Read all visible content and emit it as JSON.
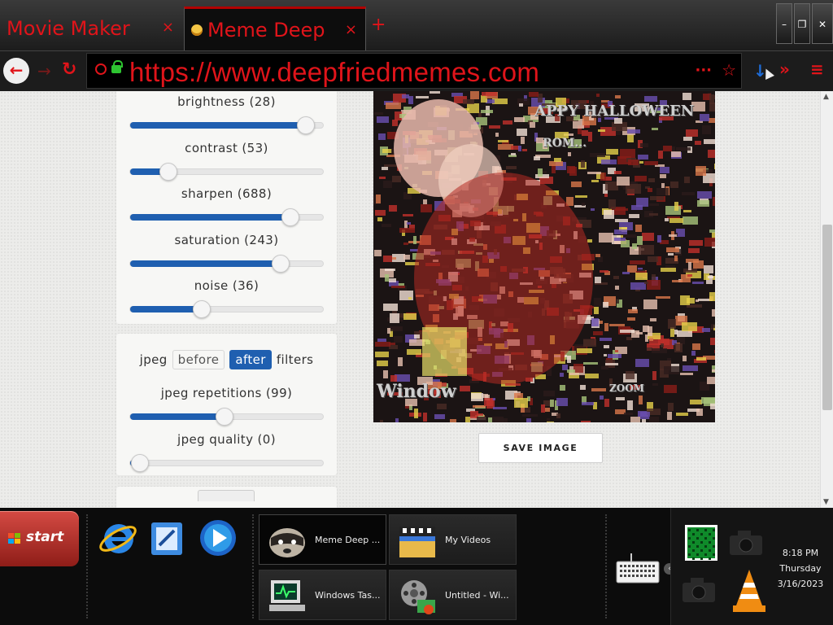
{
  "browser": {
    "tabs": [
      {
        "label": "Movie Maker",
        "active": false
      },
      {
        "label": "Meme Deep",
        "active": true
      }
    ],
    "tab_close": "×",
    "new_tab": "+",
    "window_buttons": {
      "minimize": "–",
      "restore": "❐",
      "close": "✕"
    },
    "url": "https://www.deepfriedmemes.com",
    "nav": {
      "back": "←",
      "forward": "→",
      "reload": "↻",
      "page_actions": "···",
      "bookmark": "☆",
      "download": "↓",
      "overflow": "»",
      "menu": "≡"
    }
  },
  "colors": {
    "accent_red": "#e0141a",
    "slider_blue": "#1f5fb0"
  },
  "sliders": [
    {
      "label": "brightness (28)",
      "fraction": 0.91
    },
    {
      "label": "contrast (53)",
      "fraction": 0.2
    },
    {
      "label": "sharpen (688)",
      "fraction": 0.83
    },
    {
      "label": "saturation (243)",
      "fraction": 0.78
    },
    {
      "label": "noise (36)",
      "fraction": 0.37
    }
  ],
  "jpeg": {
    "prefix": "jpeg",
    "before": "before",
    "after": "after",
    "suffix": "filters",
    "selected": "after",
    "sliders": [
      {
        "label": "jpeg repetitions (99)",
        "fraction": 0.49
      },
      {
        "label": "jpeg quality (0)",
        "fraction": 0.05
      }
    ]
  },
  "meme": {
    "captions": [
      "APPY HALLOWEEN",
      "ROM...",
      "Window",
      "ZOOM"
    ]
  },
  "save_button": "SAVE IMAGE",
  "taskbar": {
    "start": "start",
    "quick_launch": [
      "internet-explorer-icon",
      "document-icon",
      "media-player-icon"
    ],
    "tasks": [
      {
        "label": "Meme Deep ...",
        "icon": "raccoon-icon",
        "active": true
      },
      {
        "label": "My Videos",
        "icon": "film-folder-icon",
        "active": false
      },
      {
        "label": "Windows Tas...",
        "icon": "task-manager-icon",
        "active": false
      },
      {
        "label": "Untitled - Wi...",
        "icon": "movie-maker-icon",
        "active": false
      }
    ],
    "clock": {
      "time": "8:18 PM",
      "day": "Thursday",
      "date": "3/16/2023"
    }
  }
}
